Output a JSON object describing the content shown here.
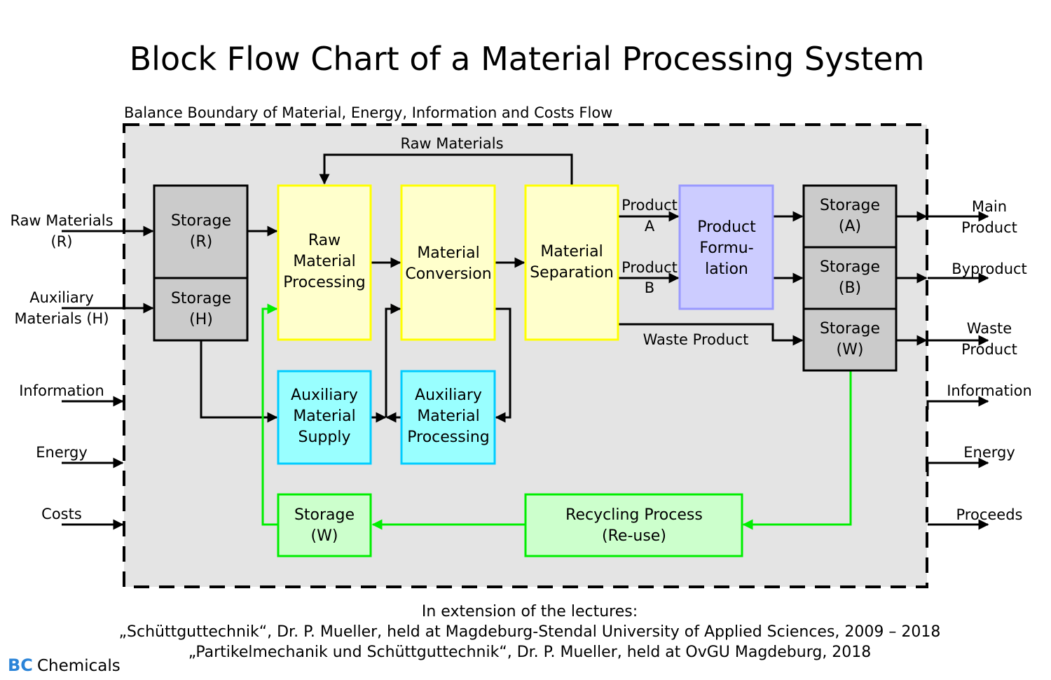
{
  "title": "Block Flow Chart of a Material Processing System",
  "boundary_label": "Balance Boundary of Material, Energy, Information and Costs Flow",
  "colors": {
    "boundary_fill": "#e4e4e4",
    "storage_fill": "#cbcbcb",
    "storage_stroke": "#000000",
    "process_fill": "#ffffcc",
    "process_stroke": "#ffff00",
    "auxiliary_fill": "#99ffff",
    "auxiliary_stroke": "#00ccff",
    "formulation_fill": "#ccccff",
    "formulation_stroke": "#9999ff",
    "recycle_fill": "#ccffcc",
    "recycle_stroke": "#00ee00",
    "brand_accent": "#2b84d8"
  },
  "inputs": {
    "raw_materials": [
      "Raw Materials",
      "(R)"
    ],
    "auxiliary_materials": [
      "Auxiliary",
      "Materials (H)"
    ],
    "information": "Information",
    "energy": "Energy",
    "costs": "Costs"
  },
  "outputs": {
    "main_product": [
      "Main",
      "Product"
    ],
    "byproduct": "Byproduct",
    "waste_product": [
      "Waste",
      "Product"
    ],
    "information": "Information",
    "energy": "Energy",
    "proceeds": "Proceeds"
  },
  "blocks": {
    "storage_r": [
      "Storage",
      "(R)"
    ],
    "storage_h": [
      "Storage",
      "(H)"
    ],
    "raw_material_processing": [
      "Raw",
      "Material",
      "Processing"
    ],
    "material_conversion": [
      "Material",
      "Conversion"
    ],
    "material_separation": [
      "Material",
      "Separation"
    ],
    "product_formulation": [
      "Product",
      "Formu-",
      "lation"
    ],
    "storage_a": [
      "Storage",
      "(A)"
    ],
    "storage_b": [
      "Storage",
      "(B)"
    ],
    "storage_w_out": [
      "Storage",
      "(W)"
    ],
    "auxiliary_material_supply": [
      "Auxiliary",
      "Material",
      "Supply"
    ],
    "auxiliary_material_processing": [
      "Auxiliary",
      "Material",
      "Processing"
    ],
    "storage_w_recycle": [
      "Storage",
      "(W)"
    ],
    "recycling_process": [
      "Recycling Process",
      "(Re-use)"
    ]
  },
  "flow_labels": {
    "raw_materials_return": "Raw Materials",
    "product_a": [
      "Product",
      "A"
    ],
    "product_b": [
      "Product",
      "B"
    ],
    "waste_product": "Waste Product"
  },
  "footer": {
    "line1": "In extension of the lectures:",
    "line2": "„Schüttguttechnik“, Dr. P. Mueller, held at Magdeburg-Stendal University of Applied Sciences, 2009 – 2018",
    "line3": "„Partikelmechanik und Schüttguttechnik“, Dr. P. Mueller, held at OvGU Magdeburg, 2018"
  },
  "brand": {
    "mark": "BC",
    "name": "Chemicals"
  }
}
